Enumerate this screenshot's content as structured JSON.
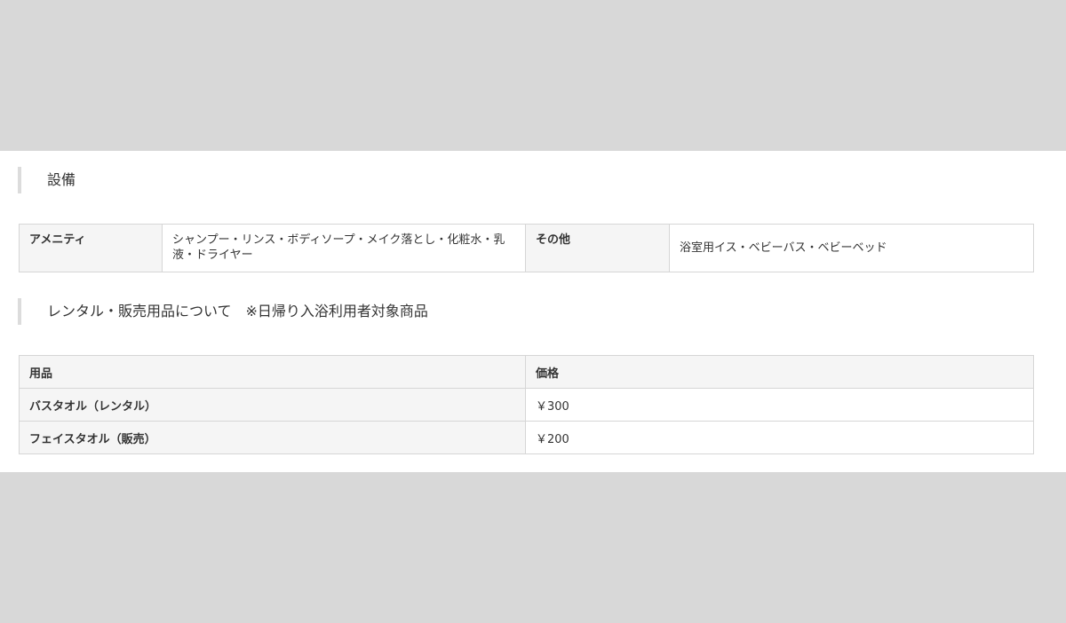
{
  "facilities": {
    "heading": "設備",
    "amenity_label": "アメニティ",
    "amenity_value": "シャンプー・リンス・ボディソープ・メイク落とし・化粧水・乳液・ドライヤー",
    "other_label": "その他",
    "other_value": "浴室用イス・ベビーバス・ベビーベッド"
  },
  "rental": {
    "heading": "レンタル・販売用品について　※日帰り入浴利用者対象商品",
    "columns": [
      "用品",
      "価格"
    ],
    "rows": [
      {
        "item": "バスタオル（レンタル）",
        "price": "￥300"
      },
      {
        "item": "フェイスタオル（販売）",
        "price": "￥200"
      }
    ]
  }
}
